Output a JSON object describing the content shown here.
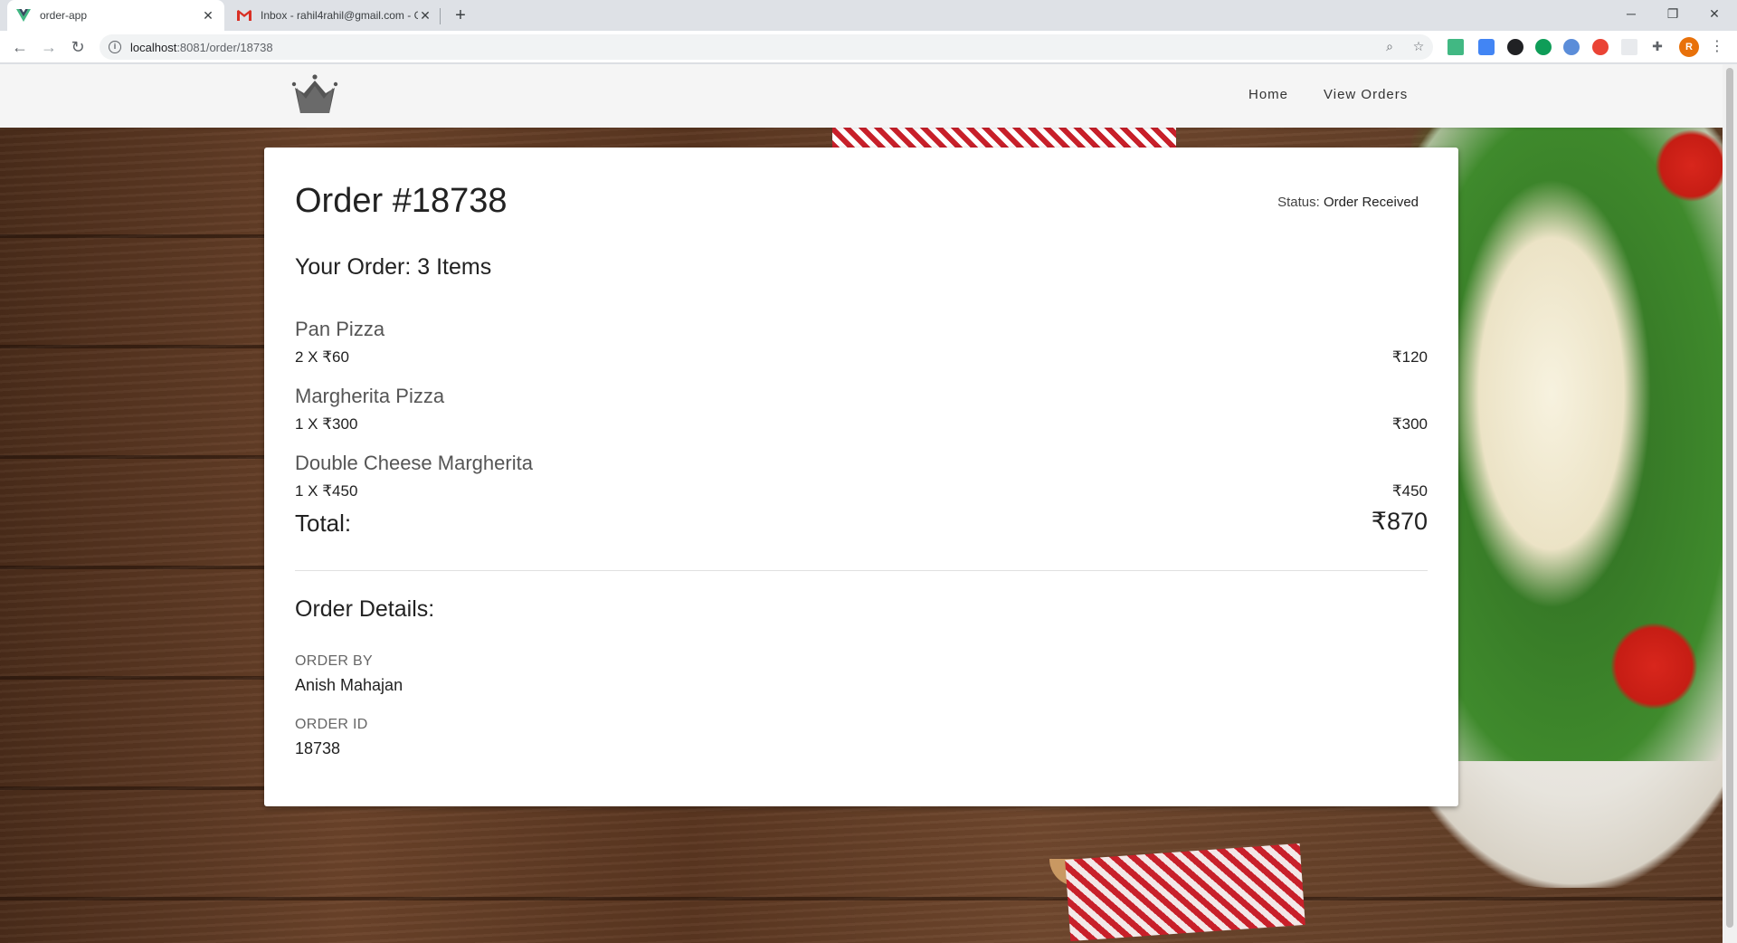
{
  "browser": {
    "tabs": [
      {
        "title": "order-app",
        "active": true
      },
      {
        "title": "Inbox - rahil4rahil@gmail.com - G",
        "active": false
      }
    ],
    "url_host": "localhost",
    "url_path": ":8081/order/18738",
    "profile_initial": "R"
  },
  "nav": {
    "home": "Home",
    "view_orders": "View Orders"
  },
  "order": {
    "title": "Order #18738",
    "status_label": "Status: ",
    "status_value": "Order Received",
    "summary": "Your Order: 3 Items",
    "items": [
      {
        "name": "Pan Pizza",
        "qty_price": "2 X ₹60",
        "total": "₹120"
      },
      {
        "name": "Margherita Pizza",
        "qty_price": "1 X ₹300",
        "total": "₹300"
      },
      {
        "name": "Double Cheese Margherita",
        "qty_price": "1 X ₹450",
        "total": "₹450"
      }
    ],
    "total_label": "Total:",
    "total_value": "₹870",
    "details_title": "Order Details:",
    "order_by_label": "ORDER BY",
    "order_by_value": "Anish Mahajan",
    "order_id_label": "ORDER ID",
    "order_id_value": "18738"
  },
  "colors": {
    "header_bg": "#f5f5f5",
    "card_bg": "#ffffff",
    "vue_green": "#41b883",
    "gmail_red": "#d93025"
  }
}
